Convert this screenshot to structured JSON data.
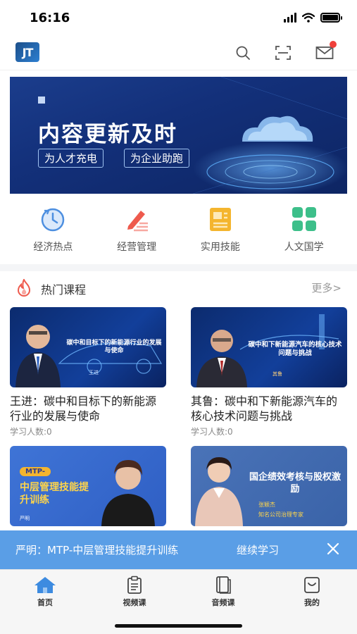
{
  "status_bar": {
    "time": "16:16"
  },
  "header": {
    "logo_text": "JT",
    "icons": [
      "search-icon",
      "scan-icon",
      "mail-icon"
    ],
    "mail_has_badge": true
  },
  "banner": {
    "title": "内容更新及时",
    "tags": [
      "为人才充电",
      "为企业助跑"
    ]
  },
  "categories": [
    {
      "label": "经济热点",
      "icon": "clock-refresh-icon",
      "color": "#4d8fe0"
    },
    {
      "label": "经营管理",
      "icon": "pen-icon",
      "color": "#ee5a4d"
    },
    {
      "label": "实用技能",
      "icon": "document-icon",
      "color": "#f4b52e"
    },
    {
      "label": "人文国学",
      "icon": "grid-icon",
      "color": "#3dbf8a"
    }
  ],
  "hot_courses": {
    "title": "热门课程",
    "more_label": "更多>",
    "courses": [
      {
        "title": "王进：碳中和目标下的新能源行业的发展与使命",
        "count": "学习人数:0",
        "thumb_heading": "碳中和目标下的新能源行业的发展与使命",
        "thumb_name": "王进"
      },
      {
        "title": "其鲁：碳中和下新能源汽车的核心技术问题与挑战",
        "count": "学习人数:0",
        "thumb_heading": "碳中和下新能源汽车的核心技术问题与挑战",
        "thumb_name": "其鲁"
      },
      {
        "title": "",
        "count": "",
        "thumb_tag": "MTP-",
        "thumb_heading": "中层管理技能提升训练",
        "thumb_name": "严明"
      },
      {
        "title": "",
        "count": "",
        "thumb_heading": "国企绩效考核与股权激励",
        "thumb_name": "张颖杰",
        "thumb_subtitle": "知名公司治理专家"
      }
    ]
  },
  "continue_bar": {
    "text": "严明：MTP-中层管理技能提升训练",
    "button": "继续学习"
  },
  "tabbar": {
    "tabs": [
      {
        "label": "首页",
        "icon": "home-icon",
        "active": true
      },
      {
        "label": "视频课",
        "icon": "clipboard-icon",
        "active": false
      },
      {
        "label": "音频课",
        "icon": "book-icon",
        "active": false
      },
      {
        "label": "我的",
        "icon": "profile-icon",
        "active": false
      }
    ]
  },
  "colors": {
    "accent": "#5a9ee6",
    "tab_active": "#3d8be0",
    "banner_bg": "#13307a"
  }
}
